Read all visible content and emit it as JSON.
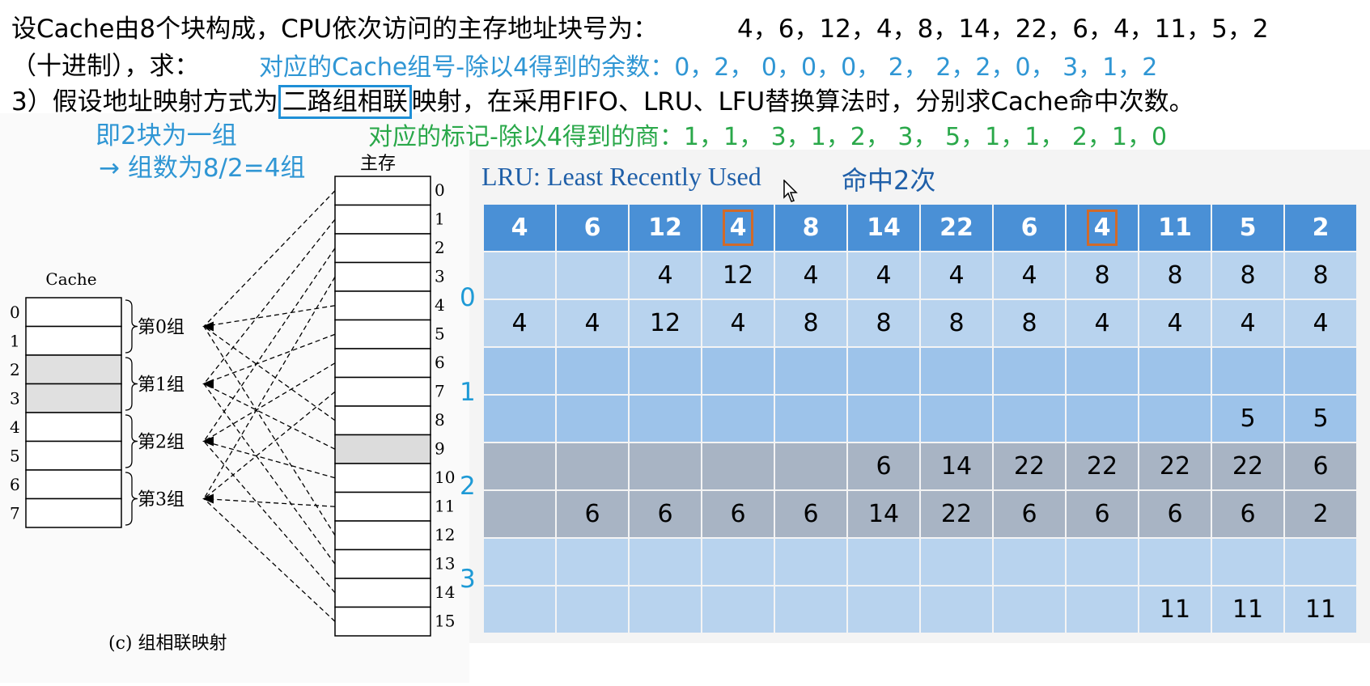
{
  "header": {
    "line1_prefix": "设Cache由8个块构成，CPU依次访问的主存地址块号为：",
    "line1_seq": "4，6，12，4，8，14，22，6，4，11，5，2",
    "line2_prefix": "（十进制），求：",
    "line2_sets": "对应的Cache组号-除以4得到的余数：0，2， 0，0，0， 2， 2，2，0， 3，1，2",
    "line3_a": "3）假设地址映射方式为",
    "line3_highlight": "二路组相联",
    "line3_b": "映射，在采用FIFO、LRU、LFU替换算法时，分别求Cache命中次数。",
    "note_group": "即2块为一组",
    "note_tags": "对应的标记-除以4得到的商：1，1， 3，1，2， 3， 5，1，1， 2，1，0",
    "note_sets": "→ 组数为8/2=4组"
  },
  "diagram": {
    "memory_label": "主存",
    "cache_label": "Cache",
    "caption": "(c) 组相联映射",
    "cache_lines": [
      "0",
      "1",
      "2",
      "3",
      "4",
      "5",
      "6",
      "7"
    ],
    "groups": [
      "第0组",
      "第1组",
      "第2组",
      "第3组"
    ],
    "memory_blocks": [
      "0",
      "1",
      "2",
      "3",
      "4",
      "5",
      "6",
      "7",
      "8",
      "9",
      "10",
      "11",
      "12",
      "13",
      "14",
      "15"
    ]
  },
  "lru": {
    "title": "LRU:  Least Recently Used",
    "hits": "命中2次",
    "set_labels": [
      "0",
      "1",
      "2",
      "3"
    ],
    "access_sequence": [
      "4",
      "6",
      "12",
      "4",
      "8",
      "14",
      "22",
      "6",
      "4",
      "11",
      "5",
      "2"
    ],
    "hit_columns": [
      3,
      8
    ],
    "rows": [
      [
        "",
        "",
        "4",
        "12",
        "4",
        "4",
        "4",
        "4",
        "8",
        "8",
        "8",
        "8"
      ],
      [
        "4",
        "4",
        "12",
        "4",
        "8",
        "8",
        "8",
        "8",
        "4",
        "4",
        "4",
        "4"
      ],
      [
        "",
        "",
        "",
        "",
        "",
        "",
        "",
        "",
        "",
        "",
        "",
        ""
      ],
      [
        "",
        "",
        "",
        "",
        "",
        "",
        "",
        "",
        "",
        "",
        "5",
        "5"
      ],
      [
        "",
        "",
        "",
        "",
        "",
        "6",
        "14",
        "22",
        "22",
        "22",
        "22",
        "6"
      ],
      [
        "",
        "6",
        "6",
        "6",
        "6",
        "14",
        "22",
        "6",
        "6",
        "6",
        "6",
        "2"
      ],
      [
        "",
        "",
        "",
        "",
        "",
        "",
        "",
        "",
        "",
        "",
        "",
        ""
      ],
      [
        "",
        "",
        "",
        "",
        "",
        "",
        "",
        "",
        "",
        "11",
        "11",
        "11"
      ]
    ]
  }
}
